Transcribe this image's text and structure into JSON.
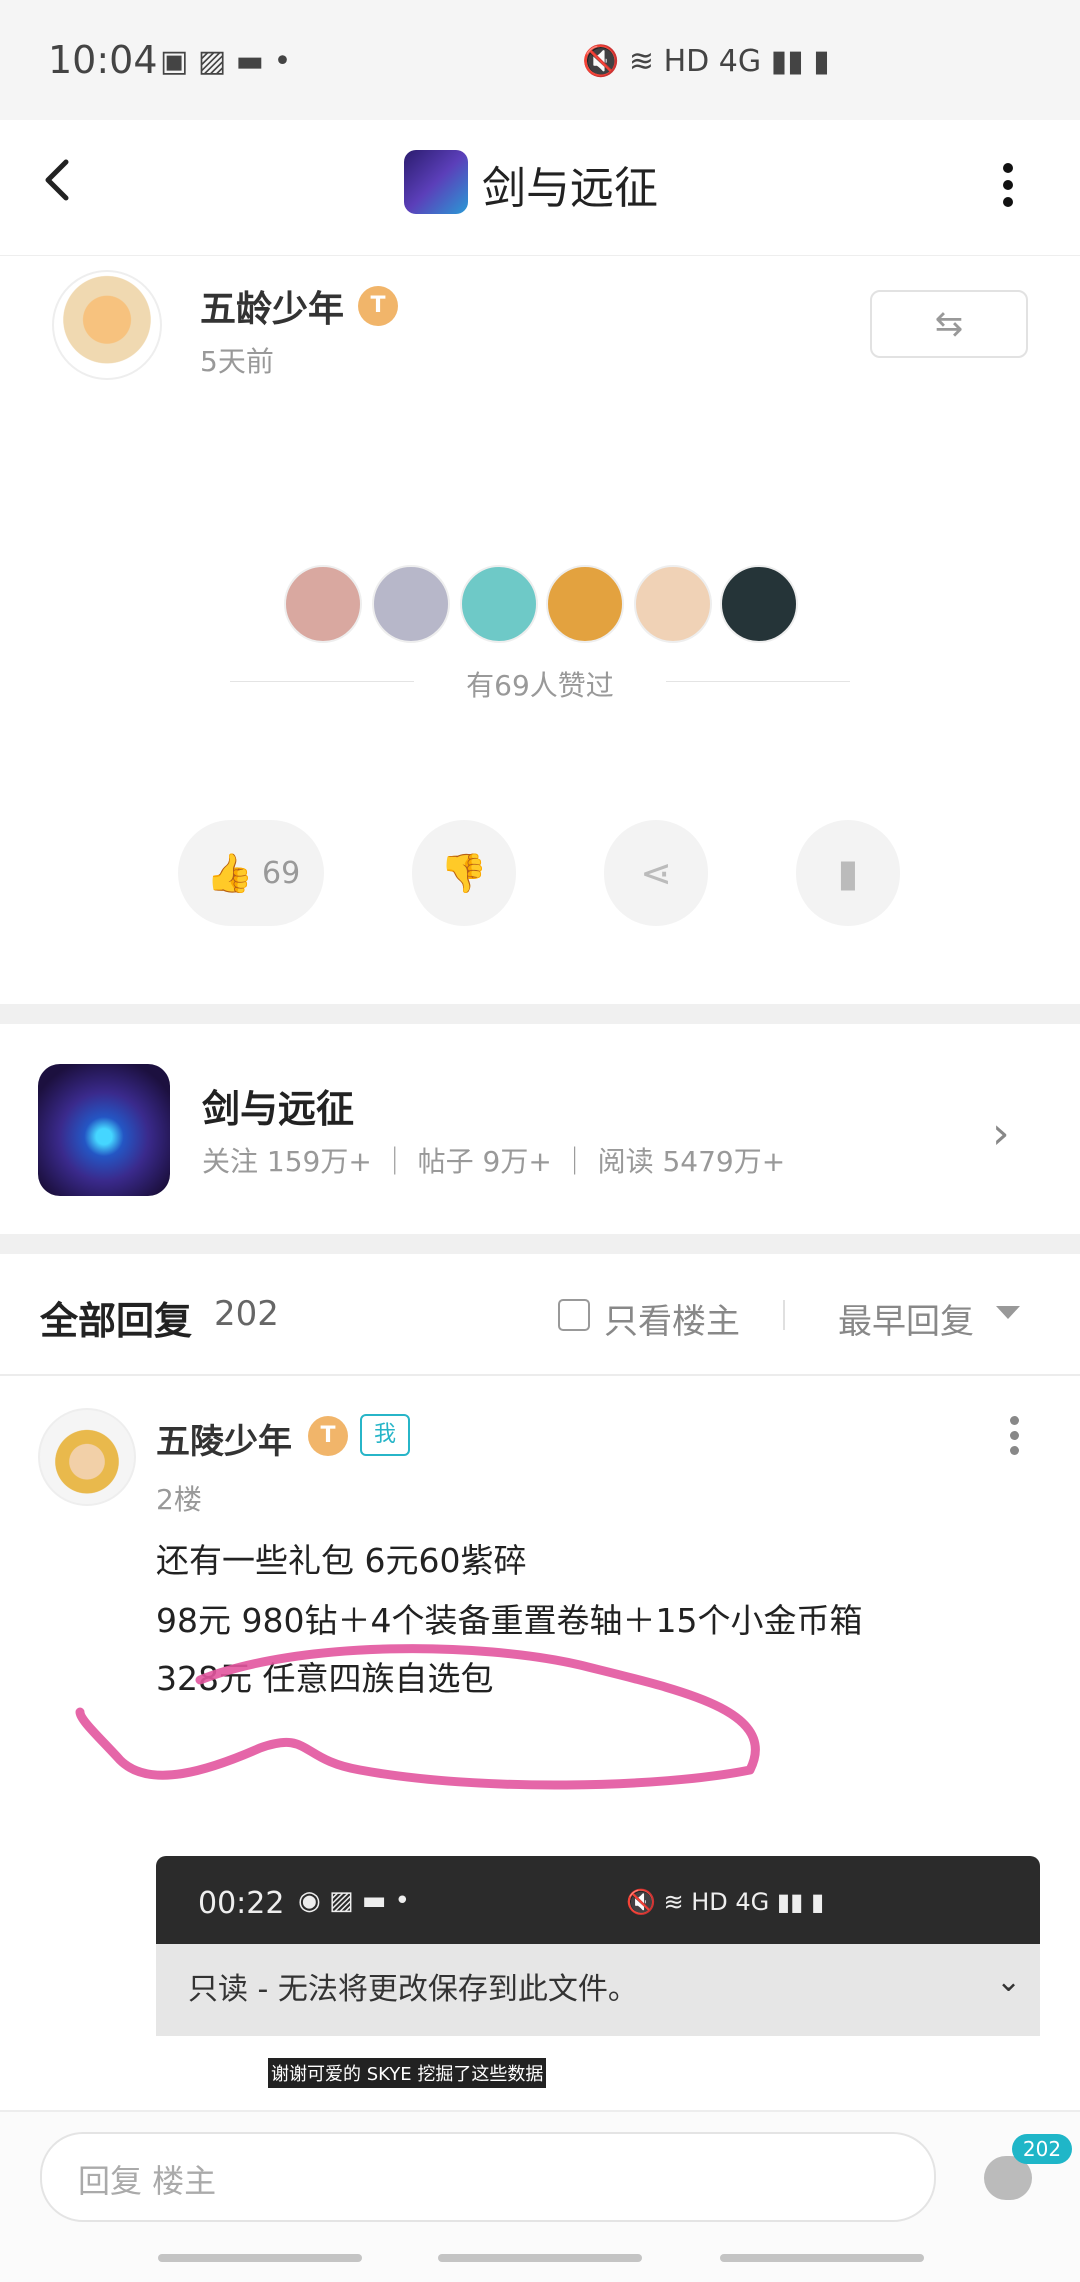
{
  "status_bar": {
    "time": "10:04",
    "left_icons": "▣ ▨ ▬ •",
    "right_icons": "🔇 ≋ HD 4G ▮▮ ▮",
    "icon_names": [
      "screenshot-icon",
      "image-icon",
      "message-icon",
      "dot-icon",
      "mute-icon",
      "wifi-icon",
      "signal-icon",
      "battery-icon"
    ]
  },
  "header": {
    "title": "剑与远征",
    "back_icon": "chevron-left-icon",
    "more_icon": "more-vertical-icon"
  },
  "author": {
    "name": "五龄少年",
    "level_badge": "T",
    "time": "5天前",
    "repost_icon": "⇆"
  },
  "likes": {
    "text": "有69人赞过",
    "avatar_colors": [
      "#d9a8a0",
      "#b7b7c9",
      "#6ec9c7",
      "#e3a23f",
      "#f0d2b6",
      "#253438"
    ]
  },
  "actions": {
    "like_icon": "👍",
    "like_count": "69",
    "dislike_icon": "👎",
    "share_icon": "⋖",
    "bookmark_icon": "▮"
  },
  "game_card": {
    "name": "剑与远征",
    "stats": "关注 159万+ ｜ 帖子 9万+ ｜ 阅读 5479万+",
    "chevron": "›"
  },
  "replies_header": {
    "title": "全部回复",
    "count": "202",
    "only_op": "只看楼主",
    "sort": "最早回复"
  },
  "reply": {
    "name": "五陵少年",
    "level_badge": "T",
    "me_badge": "我",
    "floor": "2楼",
    "lines": [
      "还有一些礼包  6元60紫碎",
      "98元 980钻＋4个装备重置卷轴＋15个小金币箱",
      "328元  任意四族自选包"
    ],
    "embedded": {
      "time": "00:22",
      "icons": "◉ ▨ ▬ •",
      "right_icons": "🔇 ≋ HD 4G ▮▮ ▮",
      "message": "只读 - 无法将更改保存到此文件。",
      "caption": "谢谢可爱的 SKYE 挖掘了这些数据"
    }
  },
  "bottom_bar": {
    "placeholder": "回复  楼主",
    "comment_badge": "202"
  },
  "colors": {
    "accent": "#1fb6c8",
    "annotation_pink": "#e2559f",
    "coin": "#f1b56a"
  }
}
